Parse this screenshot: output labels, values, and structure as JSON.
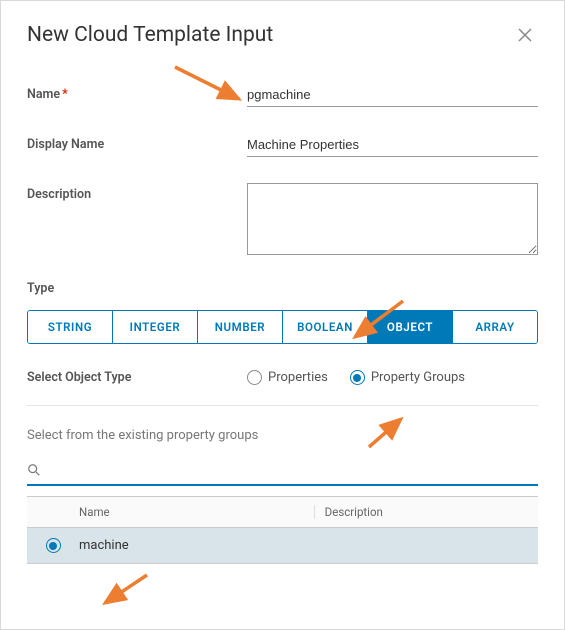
{
  "modal": {
    "title": "New Cloud Template Input"
  },
  "form": {
    "name_label": "Name",
    "name_value": "pgmachine",
    "display_name_label": "Display Name",
    "display_name_value": "Machine Properties",
    "description_label": "Description",
    "description_value": ""
  },
  "type": {
    "label": "Type",
    "options": [
      "STRING",
      "INTEGER",
      "NUMBER",
      "BOOLEAN",
      "OBJECT",
      "ARRAY"
    ],
    "selected": "OBJECT"
  },
  "object_type": {
    "label": "Select Object Type",
    "options": [
      {
        "label": "Properties",
        "value": "properties",
        "checked": false
      },
      {
        "label": "Property Groups",
        "value": "property_groups",
        "checked": true
      }
    ]
  },
  "list": {
    "caption": "Select from the existing property groups",
    "search_placeholder": "",
    "columns": {
      "name": "Name",
      "description": "Description"
    },
    "rows": [
      {
        "name": "machine",
        "description": "",
        "selected": true
      }
    ]
  },
  "colors": {
    "accent": "#0079b8",
    "arrow": "#ed7d31"
  }
}
